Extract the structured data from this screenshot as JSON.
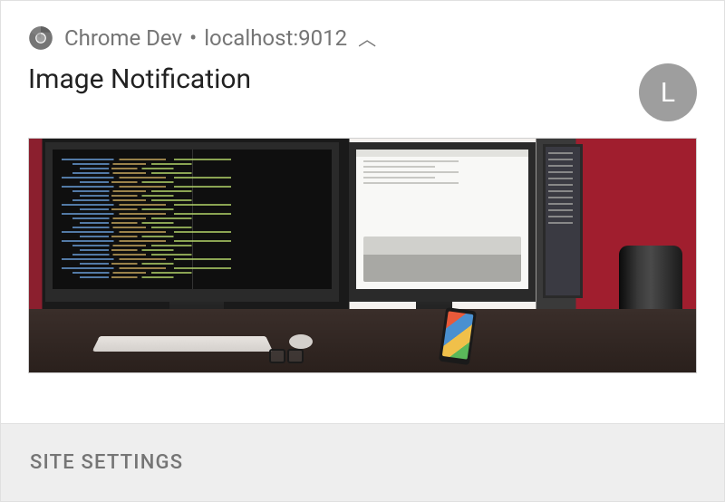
{
  "header": {
    "app_name": "Chrome Dev",
    "origin": "localhost:9012",
    "separator": "•"
  },
  "notification": {
    "title": "Image Notification",
    "avatar_letter": "L"
  },
  "actions": {
    "site_settings": "SITE SETTINGS"
  }
}
